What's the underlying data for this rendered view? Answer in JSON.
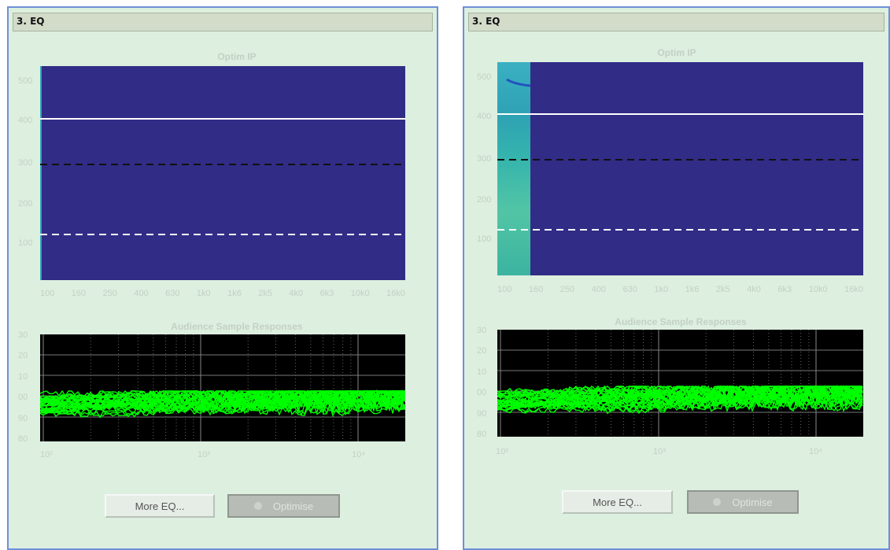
{
  "panels": [
    {
      "title": "3. EQ",
      "optim": {
        "title": "Optim IP",
        "y_ticks": [
          "500",
          "400",
          "300",
          "200",
          "100"
        ],
        "x_ticks": [
          "100",
          "160",
          "250",
          "400",
          "630",
          "1k0",
          "1k6",
          "2k5",
          "4k0",
          "6k3",
          "10k0",
          "16k0"
        ]
      },
      "audience": {
        "title": "Audience Sample Responses",
        "y_ticks": [
          "30",
          "20",
          "10",
          "00",
          "90",
          "80"
        ],
        "x_ticks": [
          "10²",
          "10³",
          "10⁴"
        ]
      },
      "buttons": {
        "more_eq": "More EQ...",
        "optimise": "Optimise"
      }
    },
    {
      "title": "3. EQ",
      "optim": {
        "title": "Optim IP",
        "y_ticks": [
          "500",
          "400",
          "300",
          "200",
          "100"
        ],
        "x_ticks": [
          "100",
          "160",
          "250",
          "400",
          "630",
          "1k0",
          "1k6",
          "2k5",
          "4k0",
          "6k3",
          "10k0",
          "16k0"
        ]
      },
      "audience": {
        "title": "Audience Sample Responses",
        "y_ticks": [
          "30",
          "20",
          "10",
          "00",
          "90",
          "80"
        ],
        "x_ticks": [
          "10²",
          "10³",
          "10⁴"
        ]
      },
      "buttons": {
        "more_eq": "More EQ...",
        "optimise": "Optimise"
      }
    }
  ],
  "colors": {
    "plot_bg": "#312c86",
    "response_trace": "#00ff00",
    "audience_bg": "#000000",
    "heat_band": "#2fa7b8"
  }
}
